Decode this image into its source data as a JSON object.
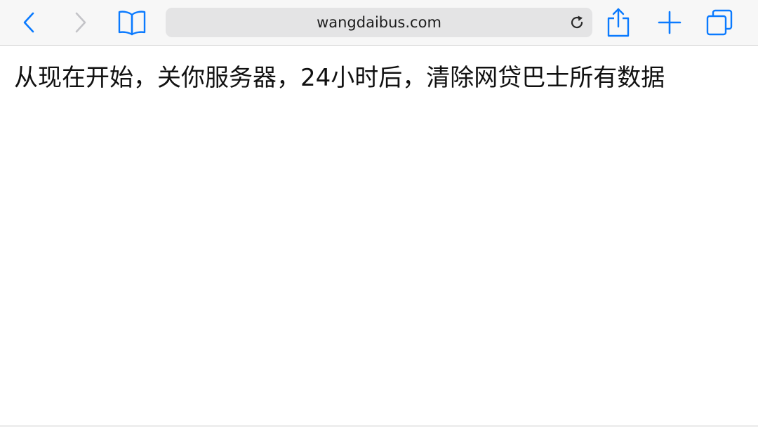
{
  "browser": {
    "address_bar": {
      "url": "wangdaibus.com"
    },
    "icons": {
      "back": "chevron-left-icon",
      "forward": "chevron-right-icon",
      "bookmarks": "open-book-icon",
      "reload": "reload-icon",
      "share": "share-icon",
      "new_tab": "plus-icon",
      "tabs": "tabs-icon"
    },
    "colors": {
      "accent": "#0a7aff",
      "disabled": "#c4c4c8",
      "toolbar_bg": "#f7f7f7",
      "address_bg": "#e4e4e5"
    }
  },
  "page": {
    "message": "从现在开始，关你服务器，24小时后，清除网贷巴士所有数据"
  }
}
